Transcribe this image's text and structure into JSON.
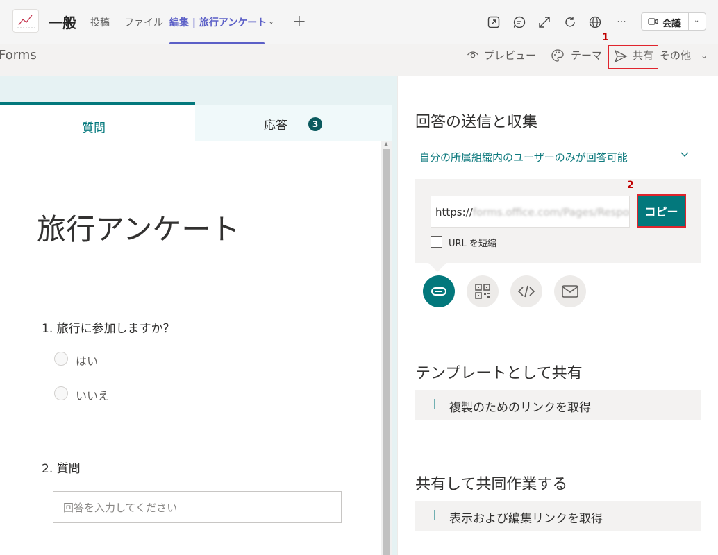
{
  "teams": {
    "channel_name": "一般",
    "tabs": [
      {
        "label": "投稿"
      },
      {
        "label": "ファイル"
      },
      {
        "label": "編集 | 旅行アンケート"
      }
    ],
    "add_tab_symbol": "+",
    "tool_icons": [
      "popout-icon",
      "conversation-icon",
      "expand-icon",
      "reload-icon",
      "globe-icon",
      "more-icon"
    ],
    "more_symbol": "···",
    "meet_label": "会議",
    "accent_color": "#5b5fc7"
  },
  "forms_bar": {
    "app_title": "Forms",
    "preview_label": "プレビュー",
    "theme_label": "テーマ",
    "share_label": "共有",
    "more_label": "その他"
  },
  "markers": {
    "step1": "1",
    "step2": "2"
  },
  "form": {
    "tab_questions": "質問",
    "tab_responses": "応答",
    "responses_count": "3",
    "title": "旅行アンケート",
    "q1": {
      "text": "1. 旅行に参加しますか？",
      "options": [
        "はい",
        "いいえ"
      ]
    },
    "q2": {
      "text": "2. 質問",
      "placeholder": "回答を入力してください"
    },
    "accent_color": "#03787c"
  },
  "share_panel": {
    "title": "回答の送信と収集",
    "permission": "自分の所属組織内のユーザーのみが回答可能",
    "url_prefix": "https://",
    "url_rest": "forms.office.com/Pages/Respon",
    "copy_label": "コピー",
    "shorten_label": "URL を短縮",
    "options": [
      "link-icon",
      "qr-code-icon",
      "embed-icon",
      "mail-icon"
    ],
    "template_title": "テンプレートとして共有",
    "template_action": "複製のためのリンクを取得",
    "collab_title": "共有して共同作業する",
    "collab_action": "表示および編集リンクを取得"
  },
  "highlight_color": "#e0242d"
}
